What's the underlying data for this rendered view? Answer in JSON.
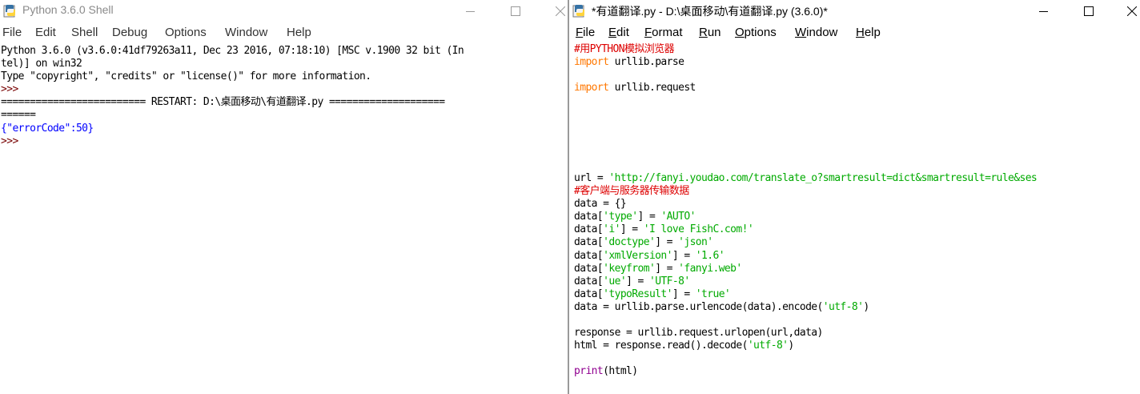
{
  "shell": {
    "title": "Python 3.6.0 Shell",
    "menu": [
      "File",
      "Edit",
      "Shell",
      "Debug",
      "Options",
      "Window",
      "Help"
    ],
    "lines": [
      {
        "text": "Python 3.6.0 (v3.6.0:41df79263a11, Dec 23 2016, 07:18:10) [MSC v.1900 32 bit (In",
        "kind": "plain"
      },
      {
        "text": "tel)] on win32",
        "kind": "plain"
      },
      {
        "text": "Type \"copyright\", \"credits\" or \"license()\" for more information.",
        "kind": "plain"
      },
      {
        "text": ">>> ",
        "kind": "prompt"
      },
      {
        "text": "========================= RESTART: D:\\桌面移动\\有道翻译.py ====================",
        "kind": "plain"
      },
      {
        "text": "======",
        "kind": "plain"
      },
      {
        "text": "{\"errorCode\":50}",
        "kind": "out"
      },
      {
        "text": ">>> ",
        "kind": "prompt"
      }
    ]
  },
  "editor": {
    "title": "*有道翻译.py - D:\\桌面移动\\有道翻译.py (3.6.0)*",
    "menu": [
      "File",
      "Edit",
      "Format",
      "Run",
      "Options",
      "Window",
      "Help"
    ],
    "code": [
      [
        [
          "#用PYTHON模拟浏览器",
          "cmt"
        ]
      ],
      [
        [
          "import",
          "kw"
        ],
        [
          " urllib.parse",
          ""
        ]
      ],
      [],
      [
        [
          "import",
          "kw"
        ],
        [
          " urllib.request",
          ""
        ]
      ],
      [],
      [],
      [],
      [],
      [],
      [],
      [
        [
          "url = ",
          ""
        ],
        [
          "'http://fanyi.youdao.com/translate_o?smartresult=dict&smartresult=rule&ses",
          "str"
        ]
      ],
      [
        [
          "#客户端与服务器传输数据",
          "cmt"
        ]
      ],
      [
        [
          "data = {}",
          ""
        ]
      ],
      [
        [
          "data[",
          ""
        ],
        [
          "'type'",
          "str"
        ],
        [
          "] = ",
          ""
        ],
        [
          "'AUTO'",
          "str"
        ]
      ],
      [
        [
          "data[",
          ""
        ],
        [
          "'i'",
          "str"
        ],
        [
          "] = ",
          ""
        ],
        [
          "'I love FishC.com!'",
          "str"
        ]
      ],
      [
        [
          "data[",
          ""
        ],
        [
          "'doctype'",
          "str"
        ],
        [
          "] = ",
          ""
        ],
        [
          "'json'",
          "str"
        ]
      ],
      [
        [
          "data[",
          ""
        ],
        [
          "'xmlVersion'",
          "str"
        ],
        [
          "] = ",
          ""
        ],
        [
          "'1.6'",
          "str"
        ]
      ],
      [
        [
          "data[",
          ""
        ],
        [
          "'keyfrom'",
          "str"
        ],
        [
          "] = ",
          ""
        ],
        [
          "'fanyi.web'",
          "str"
        ]
      ],
      [
        [
          "data[",
          ""
        ],
        [
          "'ue'",
          "str"
        ],
        [
          "] = ",
          ""
        ],
        [
          "'UTF-8'",
          "str"
        ]
      ],
      [
        [
          "data[",
          ""
        ],
        [
          "'typoResult'",
          "str"
        ],
        [
          "] = ",
          ""
        ],
        [
          "'true'",
          "str"
        ]
      ],
      [
        [
          "data = urllib.parse.urlencode(data).encode(",
          ""
        ],
        [
          "'utf-8'",
          "str"
        ],
        [
          ")",
          ""
        ]
      ],
      [],
      [
        [
          "response = urllib.request.urlopen(url,data)",
          ""
        ]
      ],
      [
        [
          "html = response.read().decode(",
          ""
        ],
        [
          "'utf-8'",
          "str"
        ],
        [
          ")",
          ""
        ]
      ],
      [],
      [
        [
          "print",
          "bi"
        ],
        [
          "(html)",
          ""
        ]
      ]
    ]
  },
  "icons": {
    "app": "python-idle-icon",
    "minimize": "minimize-icon",
    "maximize": "maximize-icon",
    "close": "close-icon"
  }
}
